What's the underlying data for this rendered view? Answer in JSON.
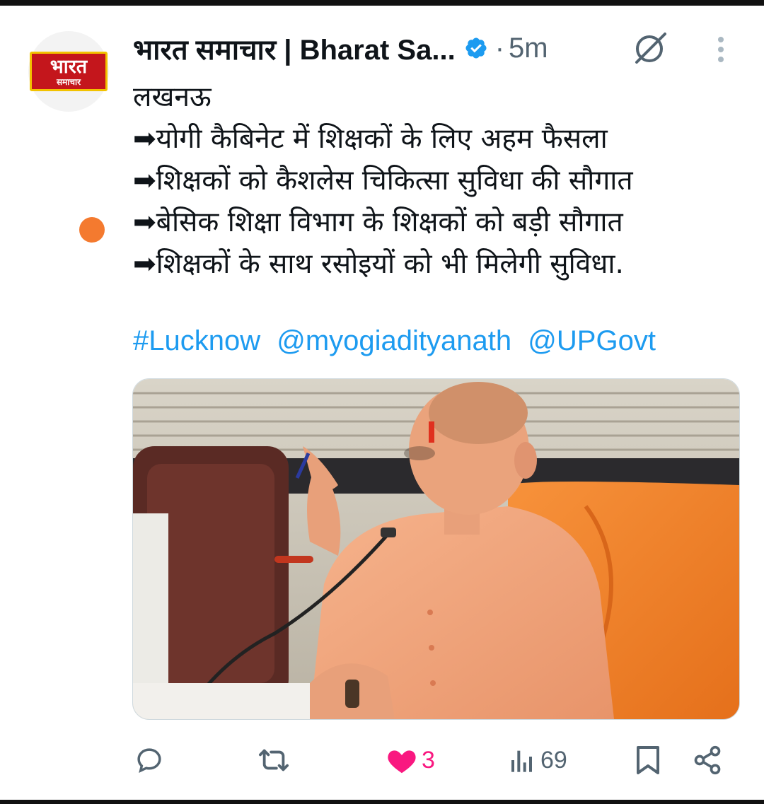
{
  "account": {
    "logo_top": "भारत",
    "logo_bottom": "समाचार",
    "display_name": "भारत समाचार | Bharat Sa...",
    "separator": "·",
    "time_ago": "5m"
  },
  "post": {
    "lines": [
      "लखनऊ",
      "➡योगी कैबिनेट में शिक्षकों के लिए अहम फैसला",
      "➡शिक्षकों को कैशलेस चिकित्सा सुविधा की सौगात",
      "➡बेसिक शिक्षा विभाग के शिक्षकों को बड़ी सौगात",
      "➡शिक्षकों के साथ रसोइयों को भी मिलेगी सुविधा."
    ],
    "links": [
      "#Lucknow",
      "@myogiadityanath",
      "@UPGovt"
    ]
  },
  "actions": {
    "reply_icon": "reply-icon",
    "repost_icon": "repost-icon",
    "like_icon": "heart-filled-icon",
    "like_count": "3",
    "views_icon": "views-icon",
    "views_count": "69",
    "bookmark_icon": "bookmark-icon",
    "share_icon": "share-icon"
  },
  "colors": {
    "link": "#1d9bf0",
    "like": "#f91880",
    "muted": "#536471",
    "logo_red": "#c4161c",
    "logo_border": "#f2c200",
    "status_dot": "#f47a2f"
  }
}
